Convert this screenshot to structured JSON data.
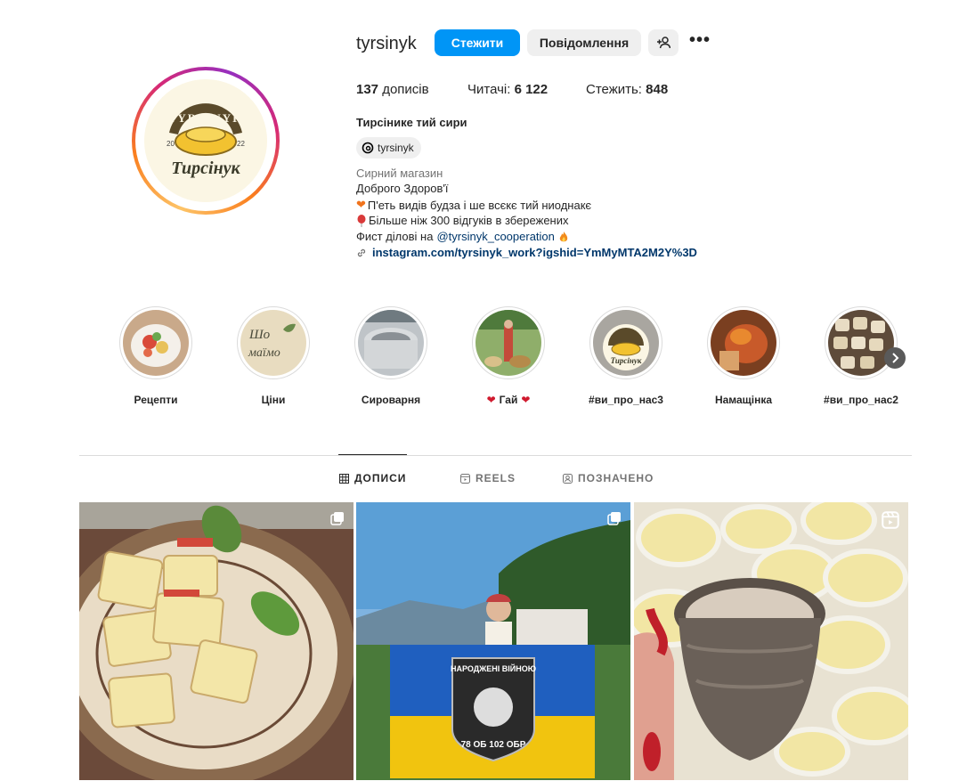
{
  "profile": {
    "username": "tyrsinyk",
    "follow_label": "Стежити",
    "message_label": "Повідомлення",
    "more_glyph": "•••",
    "logo_top": "TYRSINYK",
    "logo_year_left": "20",
    "logo_year_right": "22",
    "logo_name": "Тирсінук"
  },
  "stats": {
    "posts_count": "137",
    "posts_label": "дописів",
    "followers_label": "Читачі:",
    "followers_count": "6 122",
    "following_label": "Стежить:",
    "following_count": "848"
  },
  "bio": {
    "full_name": "Тирсінике тий сири",
    "threads_handle": "tyrsinyk",
    "category": "Сирний магазин",
    "line1": "Доброго Здоров'ї",
    "line2": "П'еть видів будза і ше всєкє тий ниоднакє",
    "line3": "Більше ніж 300 відгуків в збережених",
    "line4_prefix": "Фист ділові на",
    "line4_mention": "@tyrsinyk_cooperation",
    "link": "instagram.com/tyrsinyk_work?igshid=YmMyMTA2M2Y%3D"
  },
  "highlights": [
    {
      "label": "Рецепти"
    },
    {
      "label": "Ціни"
    },
    {
      "label": "Сироварня"
    },
    {
      "label": "Гай"
    },
    {
      "label": "#ви_про_нас3"
    },
    {
      "label": "Намащінка"
    },
    {
      "label": "#ви_про_нас2"
    }
  ],
  "highlight_text": {
    "tsiny_line1": "Шо",
    "tsiny_line2": "маїмо"
  },
  "tabs": {
    "posts": "ДОПИСИ",
    "reels": "REELS",
    "tagged": "ПОЗНАЧЕНО"
  },
  "posts": {
    "flag_text_top": "НАРОДЖЕНІ ВІЙНОЮ",
    "flag_text_bottom": "78 OБ 102 ОБР"
  },
  "colors": {
    "accent": "#0095f6",
    "link": "#00376b",
    "muted": "#737373"
  }
}
